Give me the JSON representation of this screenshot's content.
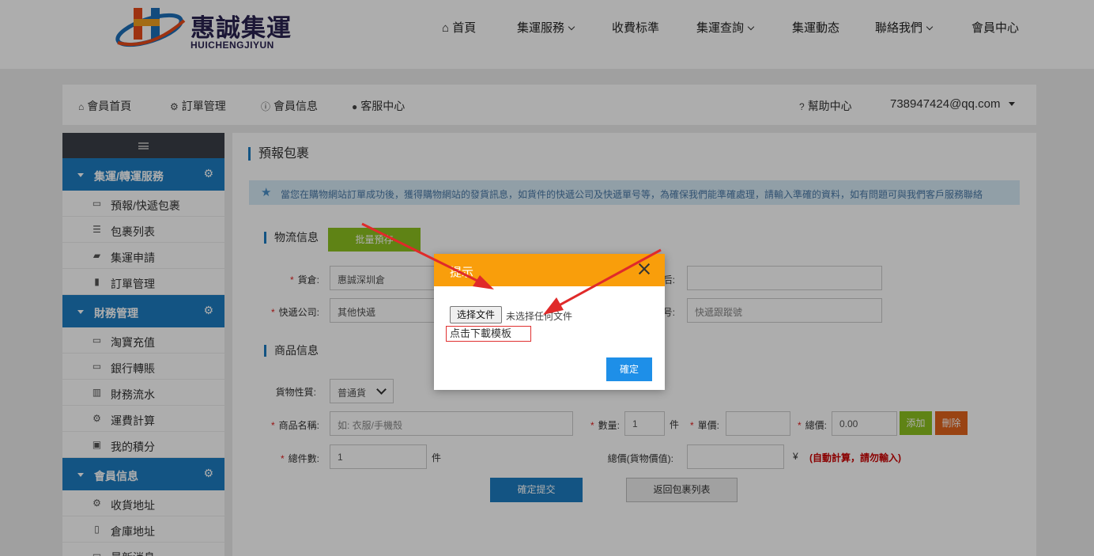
{
  "brand": {
    "name": "惠誠集運",
    "sub": "HUICHENGJIYUN"
  },
  "topnav": [
    {
      "label": "首頁",
      "icon": "home-icon",
      "dropdown": false
    },
    {
      "label": "集運服務",
      "dropdown": true
    },
    {
      "label": "收費标準",
      "dropdown": false
    },
    {
      "label": "集運查詢",
      "dropdown": true
    },
    {
      "label": "集運動态",
      "dropdown": false
    },
    {
      "label": "聯絡我們",
      "dropdown": true
    },
    {
      "label": "會員中心",
      "dropdown": false
    }
  ],
  "subnav": {
    "items": [
      {
        "label": "會員首頁",
        "icon": "home-icon"
      },
      {
        "label": "訂單管理",
        "icon": "gear-icon"
      },
      {
        "label": "會員信息",
        "icon": "info-icon"
      },
      {
        "label": "客服中心",
        "icon": "user-icon"
      }
    ],
    "help": "幫助中心",
    "user": "738947424@qq.com"
  },
  "sidebar": {
    "groups": [
      {
        "label": "集運/轉運服務",
        "items": [
          "預報/快遞包裹",
          "包裹列表",
          "集運申請",
          "訂單管理"
        ]
      },
      {
        "label": "財務管理",
        "items": [
          "淘寶充值",
          "銀行轉賬",
          "財務流水",
          "運費計算",
          "我的積分"
        ]
      },
      {
        "label": "會員信息",
        "items": [
          "收貨地址",
          "倉庫地址",
          "最新消息"
        ]
      }
    ]
  },
  "main": {
    "title": "預報包裹",
    "notice": "當您在購物網站訂單成功後，獲得購物網站的發貨訊息，如貨件的快遞公司及快遞單号等，為確保我們能準確處理，請輸入準確的資料，如有問題可與我們客戶服務聯絡",
    "logistics": {
      "title": "物流信息",
      "batch_button": "批量預存",
      "warehouse_label": "貨倉:",
      "warehouse_value": "惠誠深圳倉",
      "right_label_1": "后:",
      "right_value_1": "",
      "courier_label": "快遞公司:",
      "courier_value": "其他快遞",
      "tracking_label": "号:",
      "tracking_placeholder": "快遞跟蹤號"
    },
    "goods": {
      "title": "商品信息",
      "type_label": "貨物性質:",
      "type_value": "普通貨",
      "name_label": "商品名稱:",
      "name_placeholder": "如: 衣服/手機殼",
      "qty_label": "數量:",
      "qty_value": "1",
      "qty_unit": "件",
      "price_label": "單價:",
      "price_value": "",
      "total_label": "總價:",
      "total_value": "0.00",
      "add_button": "添加",
      "delete_button": "刪除",
      "count_label": "總件數:",
      "count_value": "1",
      "count_unit": "件",
      "grand_label": "總價(貨物價值):",
      "grand_value": "",
      "currency": "¥",
      "auto_note": "(自動計算，請勿輸入)"
    },
    "submit_button": "確定提交",
    "back_button": "返回包裹列表"
  },
  "modal": {
    "title": "提示",
    "file_button": "选择文件",
    "file_status": "未选择任何文件",
    "download_link": "点击下載模板",
    "ok_button": "確定"
  },
  "colors": {
    "brand_blue": "#1d7dc1",
    "modal_header": "#f99e0b",
    "green": "#8dc21f",
    "orange_red": "#e2631c",
    "arrow_red": "#e02a2a"
  }
}
